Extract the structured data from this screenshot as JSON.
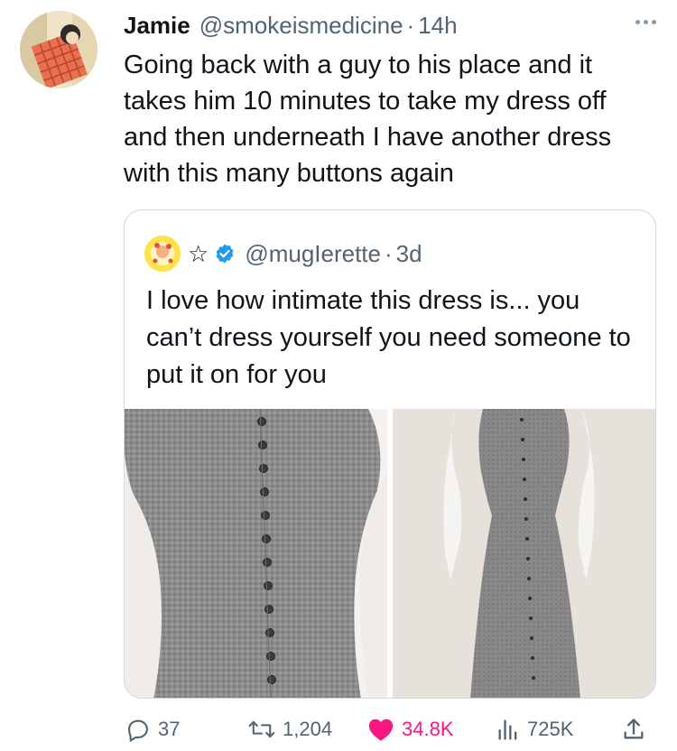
{
  "tweet": {
    "author_name": "Jamie",
    "author_handle": "@smokeismedicine",
    "separator": "·",
    "time": "14h",
    "text": "Going back with a guy to his place and it takes him 10 minutes to take my dress off and then underneath I have another dress with this many buttons again"
  },
  "quote": {
    "name_glyph": "☆",
    "handle": "@mugIerette",
    "separator": "·",
    "time": "3d",
    "text": "I love how intimate this dress is... you can’t dress yourself you need someone to put it on for you"
  },
  "actions": {
    "replies": "37",
    "retweets": "1,204",
    "likes": "34.8K",
    "views": "725K"
  },
  "colors": {
    "like": "#f91880",
    "verified": "#1d9bf0",
    "secondary_text": "#536471",
    "border": "#cfd9de"
  },
  "icons": [
    "more-icon",
    "verified-badge-icon",
    "reply-icon",
    "retweet-icon",
    "like-icon",
    "views-icon",
    "share-icon"
  ]
}
